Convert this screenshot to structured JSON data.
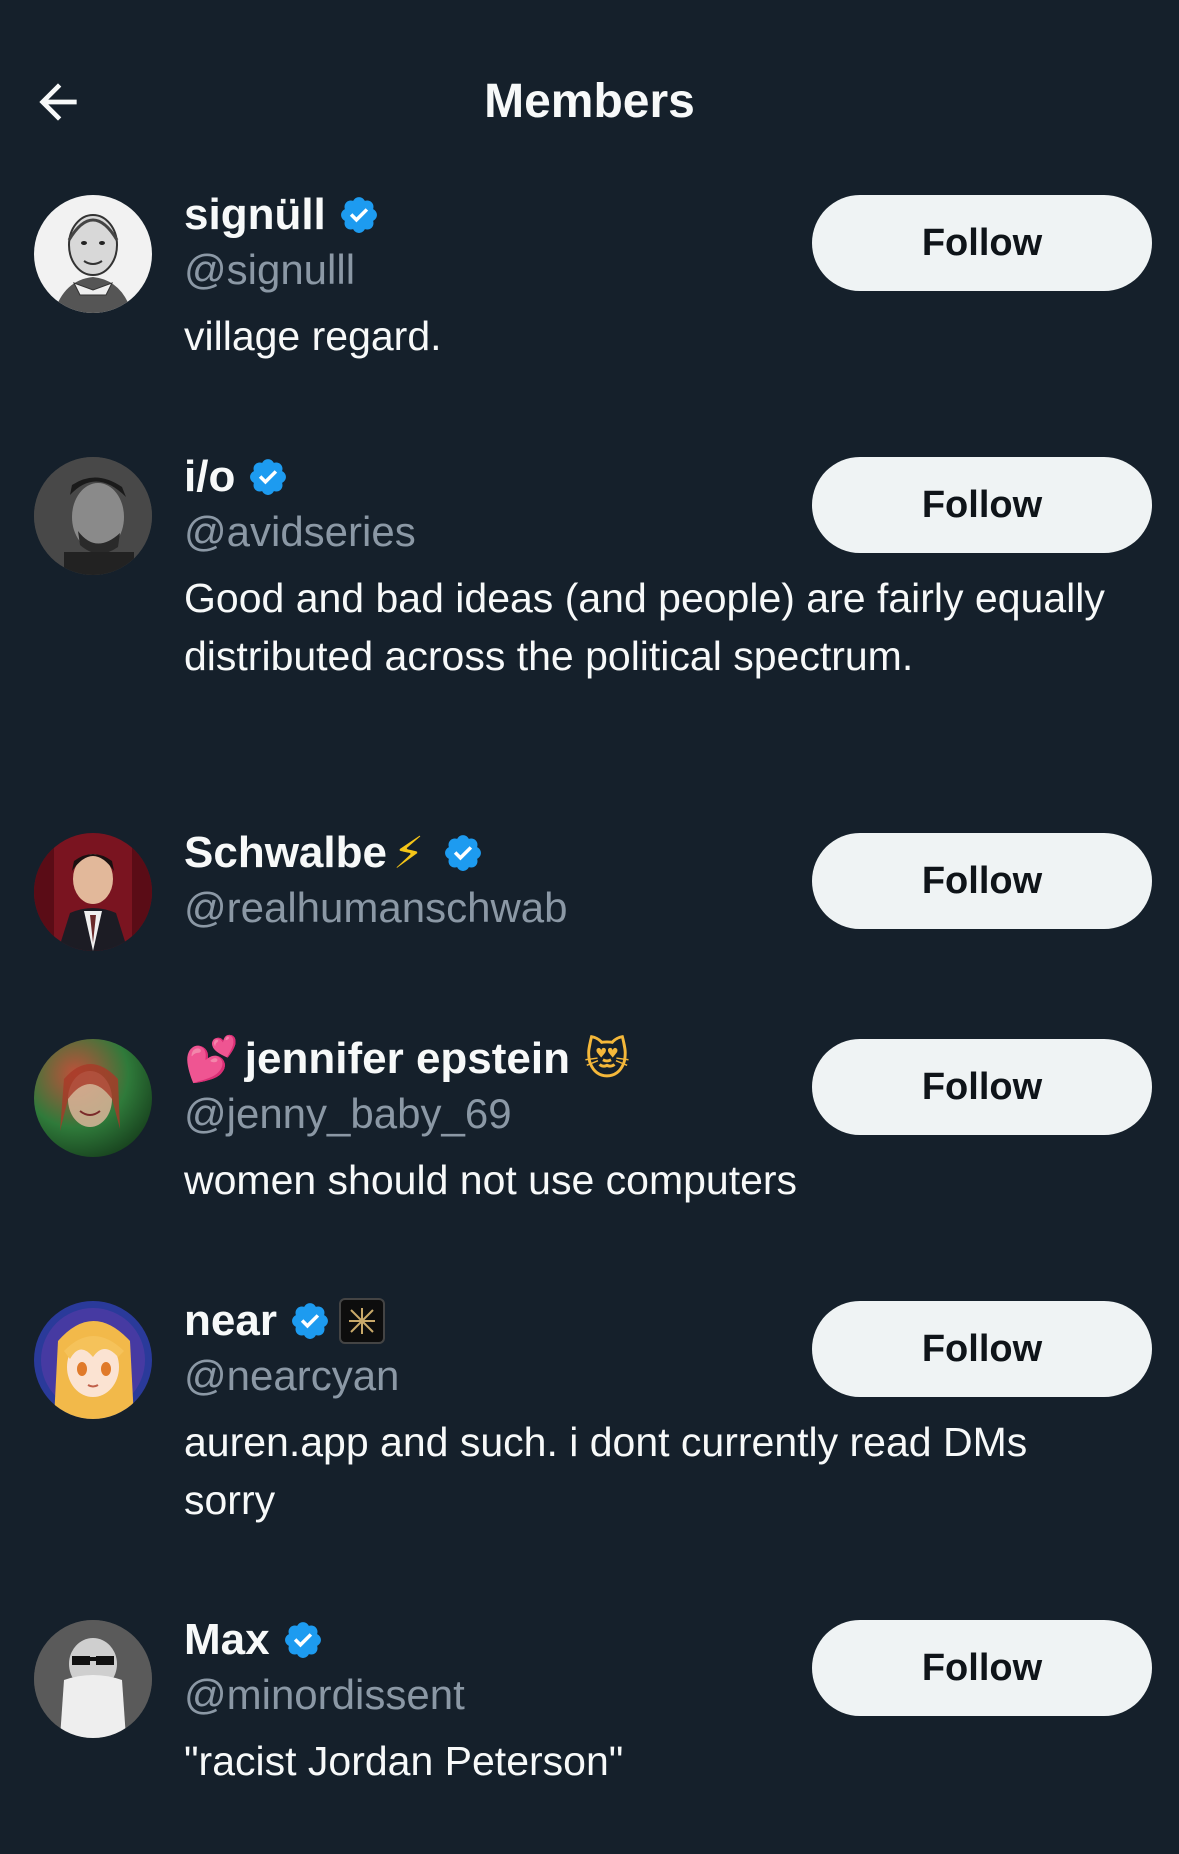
{
  "header": {
    "title": "Members",
    "back_icon": "arrow-left-icon"
  },
  "colors": {
    "background": "#15202b",
    "verified": "#1d9bf0",
    "follow_bg": "#eff3f4",
    "handle": "#8b98a5"
  },
  "members": [
    {
      "name": "signüll",
      "handle": "@signulll",
      "bio": "village regard.",
      "follow_label": "Follow"
    },
    {
      "name": "i/o",
      "handle": "@avidseries",
      "bio": "Good and bad ideas (and people) are fairly equally distributed across the political spectrum.",
      "follow_label": "Follow"
    },
    {
      "name": "Schwalbe",
      "name_emoji": "⚡",
      "handle": "@realhumanschwab",
      "bio": "",
      "follow_label": "Follow"
    },
    {
      "name_prefix_emoji": "💕",
      "name": "jennifer epstein",
      "name_emoji": "😻",
      "handle": "@jenny_baby_69",
      "bio": "women should not use computers",
      "follow_label": "Follow"
    },
    {
      "name": "near",
      "handle": "@nearcyan",
      "bio": "auren.app and such. i dont currently read DMs sorry",
      "follow_label": "Follow"
    },
    {
      "name": "Max",
      "handle": "@minordissent",
      "bio": "\"racist Jordan Peterson\"",
      "follow_label": "Follow"
    }
  ]
}
